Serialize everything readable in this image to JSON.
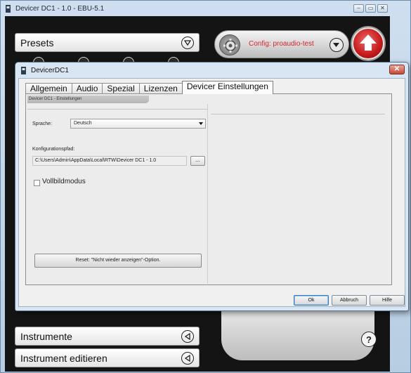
{
  "main_window": {
    "title": "Devicer DC1 - 1.0 - EBU-5.1",
    "win_buttons": [
      "–",
      "▭",
      "✕"
    ],
    "presets_label": "Presets",
    "config_label": "Config: proaudio-test",
    "instrumente_label": "Instrumente",
    "instrument_edit_label": "Instrument editieren",
    "help_label": "?"
  },
  "dialog": {
    "title": "DevicerDC1",
    "close_label": "✕",
    "tabs": [
      {
        "label": "Allgemein"
      },
      {
        "label": "Audio"
      },
      {
        "label": "Spezial"
      },
      {
        "label": "Lizenzen"
      },
      {
        "label": "Devicer Einstellungen"
      }
    ],
    "section_header": "Devicer DC1 - Einstellungen",
    "language_label": "Sprache:",
    "language_value": "Deutsch",
    "path_label": "Konfigurationspfad:",
    "path_value": "C:\\Users\\Admin\\AppData\\Local\\RTW\\Devicer DC1 - 1.0",
    "browse_label": "...",
    "fullscreen_label": "Vollbildmodus",
    "fullscreen_checked": false,
    "reset_label": "Reset: \"Nicht wieder anzeigen\"-Option.",
    "ok_label": "Ok",
    "cancel_label": "Abbruch",
    "help_label": "Hilfe"
  },
  "colors": {
    "accent_red": "#d4262c",
    "dialog_frame": "#d8e6f3"
  }
}
